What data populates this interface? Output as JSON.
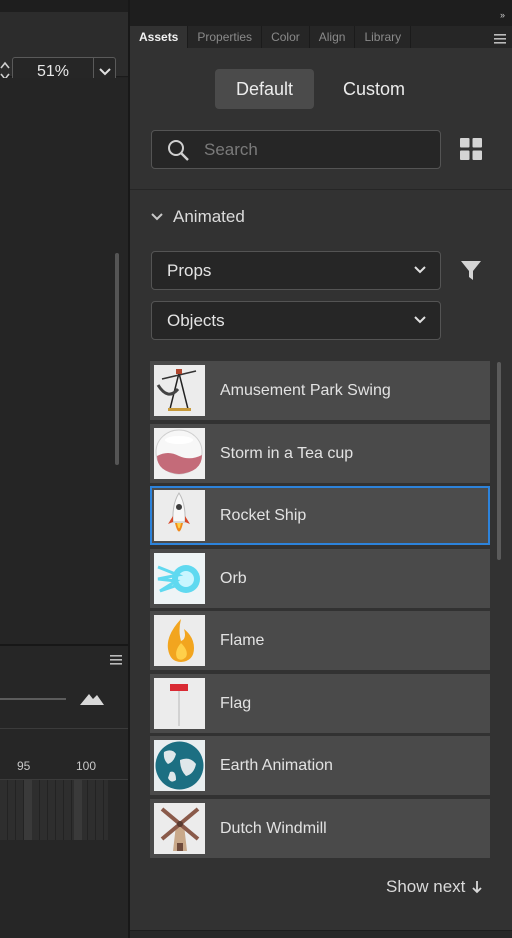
{
  "stage": {
    "zoom_value": "51%"
  },
  "timeline": {
    "ruler_labels": [
      "95",
      "100"
    ]
  },
  "panel": {
    "tabs": [
      {
        "label": "Assets",
        "active": true
      },
      {
        "label": "Properties",
        "active": false
      },
      {
        "label": "Color",
        "active": false
      },
      {
        "label": "Align",
        "active": false
      },
      {
        "label": "Library",
        "active": false
      }
    ],
    "segment": {
      "default_label": "Default",
      "custom_label": "Custom",
      "selected": "Default"
    },
    "search": {
      "placeholder": "Search",
      "value": ""
    },
    "section_title": "Animated",
    "category_select": "Props",
    "subcategory_select": "Objects",
    "assets": [
      {
        "label": "Amusement Park Swing",
        "icon": "swing-thumb",
        "selected": false
      },
      {
        "label": "Storm in a Tea cup",
        "icon": "teacup-thumb",
        "selected": false
      },
      {
        "label": "Rocket Ship",
        "icon": "rocket-thumb",
        "selected": true
      },
      {
        "label": "Orb",
        "icon": "orb-thumb",
        "selected": false
      },
      {
        "label": "Flame",
        "icon": "flame-thumb",
        "selected": false
      },
      {
        "label": "Flag",
        "icon": "flag-thumb",
        "selected": false
      },
      {
        "label": "Earth Animation",
        "icon": "earth-thumb",
        "selected": false
      },
      {
        "label": "Dutch Windmill",
        "icon": "windmill-thumb",
        "selected": false
      }
    ],
    "show_next_label": "Show next",
    "colors": {
      "selection_border": "#2d83db",
      "panel_bg": "#323232",
      "item_bg": "#4a4a4a"
    }
  }
}
